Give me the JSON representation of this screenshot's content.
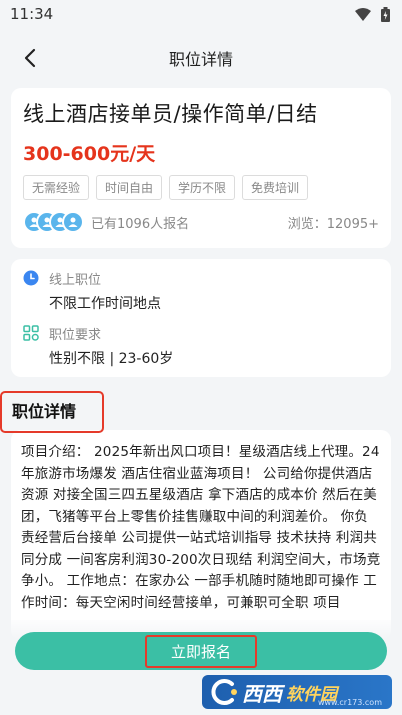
{
  "status": {
    "time": "11:34"
  },
  "nav": {
    "title": "职位详情"
  },
  "job": {
    "title": "线上酒店接单员/操作简单/日结",
    "salary": "300-600元/天",
    "tags": [
      "无需经验",
      "时间自由",
      "学历不限",
      "免费培训"
    ],
    "signup_count": "已有1096人报名",
    "views": "浏览：12095+"
  },
  "info": {
    "location_label": "线上职位",
    "location_value": "不限工作时间地点",
    "requirement_label": "职位要求",
    "requirement_value": "性别不限 | 23-60岁"
  },
  "details": {
    "section_title": "职位详情",
    "text": "项目介绍： 2025年新出风口项目！星级酒店线上代理。24年旅游市场爆发 酒店住宿业蓝海项目！ 公司给你提供酒店资源 对接全国三四五星级酒店 拿下酒店的成本价 然后在美团，飞猪等平台上零售价挂售赚取中间的利润差价。 你负责经营后台接单 公司提供一站式培训指导 技术扶持 利润共同分成 一间客房利润30-200次日现结 利润空间大，市场竞争小。 工作地点：在家办公 一部手机随时随地即可操作 工作时间：每天空闲时间经营接单，可兼职可全职 项目"
  },
  "apply": {
    "label": "立即报名"
  },
  "watermark": {
    "brand": "西西",
    "sub": "软件园",
    "url": "www.cr173.com"
  },
  "colors": {
    "accent": "#3bbfa5",
    "salary": "#e5341c",
    "highlight": "#e53a2a"
  }
}
